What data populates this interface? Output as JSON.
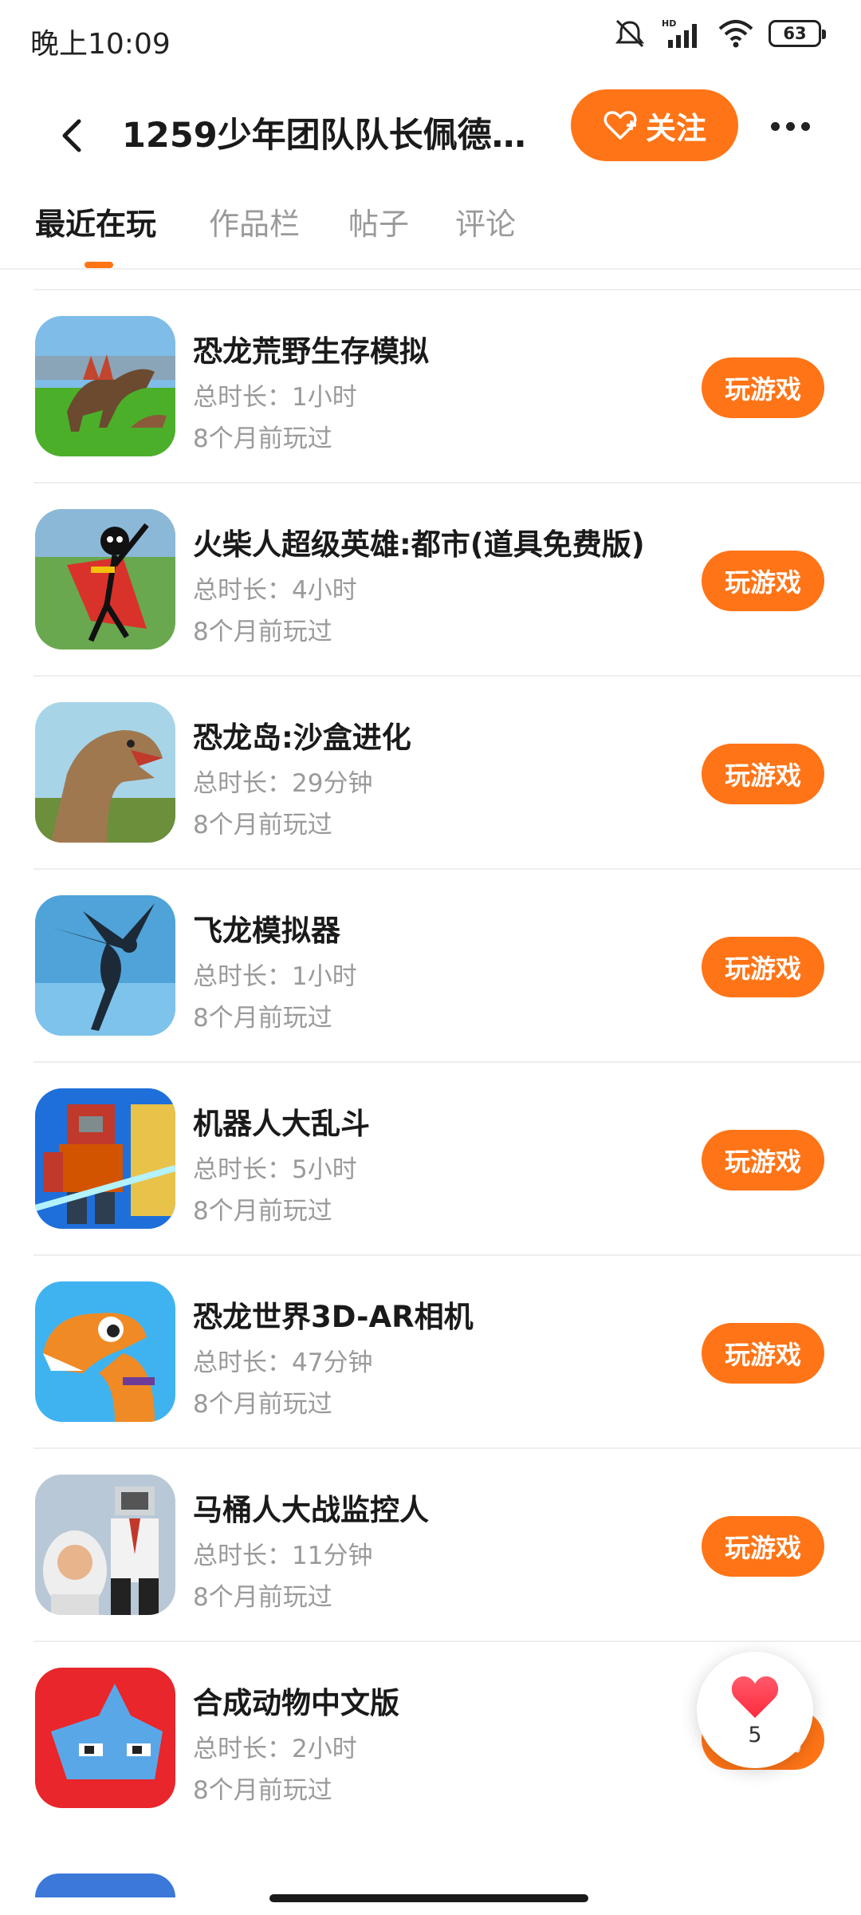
{
  "status_bar": {
    "time": "晚上10:09",
    "battery": "63",
    "network_label": "HD"
  },
  "header": {
    "back_icon": "chevron-left-icon",
    "title": "1259少年团队队长佩德罗…",
    "follow_label": "关注",
    "more_icon": "more-dots-icon"
  },
  "tabs": [
    {
      "label": "最近在玩",
      "active": true
    },
    {
      "label": "作品栏",
      "active": false
    },
    {
      "label": "帖子",
      "active": false
    },
    {
      "label": "评论",
      "active": false
    }
  ],
  "games": [
    {
      "name": "恐龙荒野生存模拟",
      "duration": "总时长：1小时",
      "last_played": "8个月前玩过",
      "button": "玩游戏"
    },
    {
      "name": "火柴人超级英雄:都市(道具免费版)",
      "duration": "总时长：4小时",
      "last_played": "8个月前玩过",
      "button": "玩游戏"
    },
    {
      "name": "恐龙岛:沙盒进化",
      "duration": "总时长：29分钟",
      "last_played": "8个月前玩过",
      "button": "玩游戏"
    },
    {
      "name": "飞龙模拟器",
      "duration": "总时长：1小时",
      "last_played": "8个月前玩过",
      "button": "玩游戏"
    },
    {
      "name": "机器人大乱斗",
      "duration": "总时长：5小时",
      "last_played": "8个月前玩过",
      "button": "玩游戏"
    },
    {
      "name": "恐龙世界3D-AR相机",
      "duration": "总时长：47分钟",
      "last_played": "8个月前玩过",
      "button": "玩游戏"
    },
    {
      "name": "马桶人大战监控人",
      "duration": "总时长：11分钟",
      "last_played": "8个月前玩过",
      "button": "玩游戏"
    },
    {
      "name": "合成动物中文版",
      "duration": "总时长：2小时",
      "last_played": "8个月前玩过",
      "button": "玩游戏"
    }
  ],
  "like_widget": {
    "icon": "heart-icon",
    "count": "5"
  },
  "colors": {
    "accent": "#ff7416",
    "text": "#1a1a1a",
    "muted": "#9a9a9a"
  }
}
